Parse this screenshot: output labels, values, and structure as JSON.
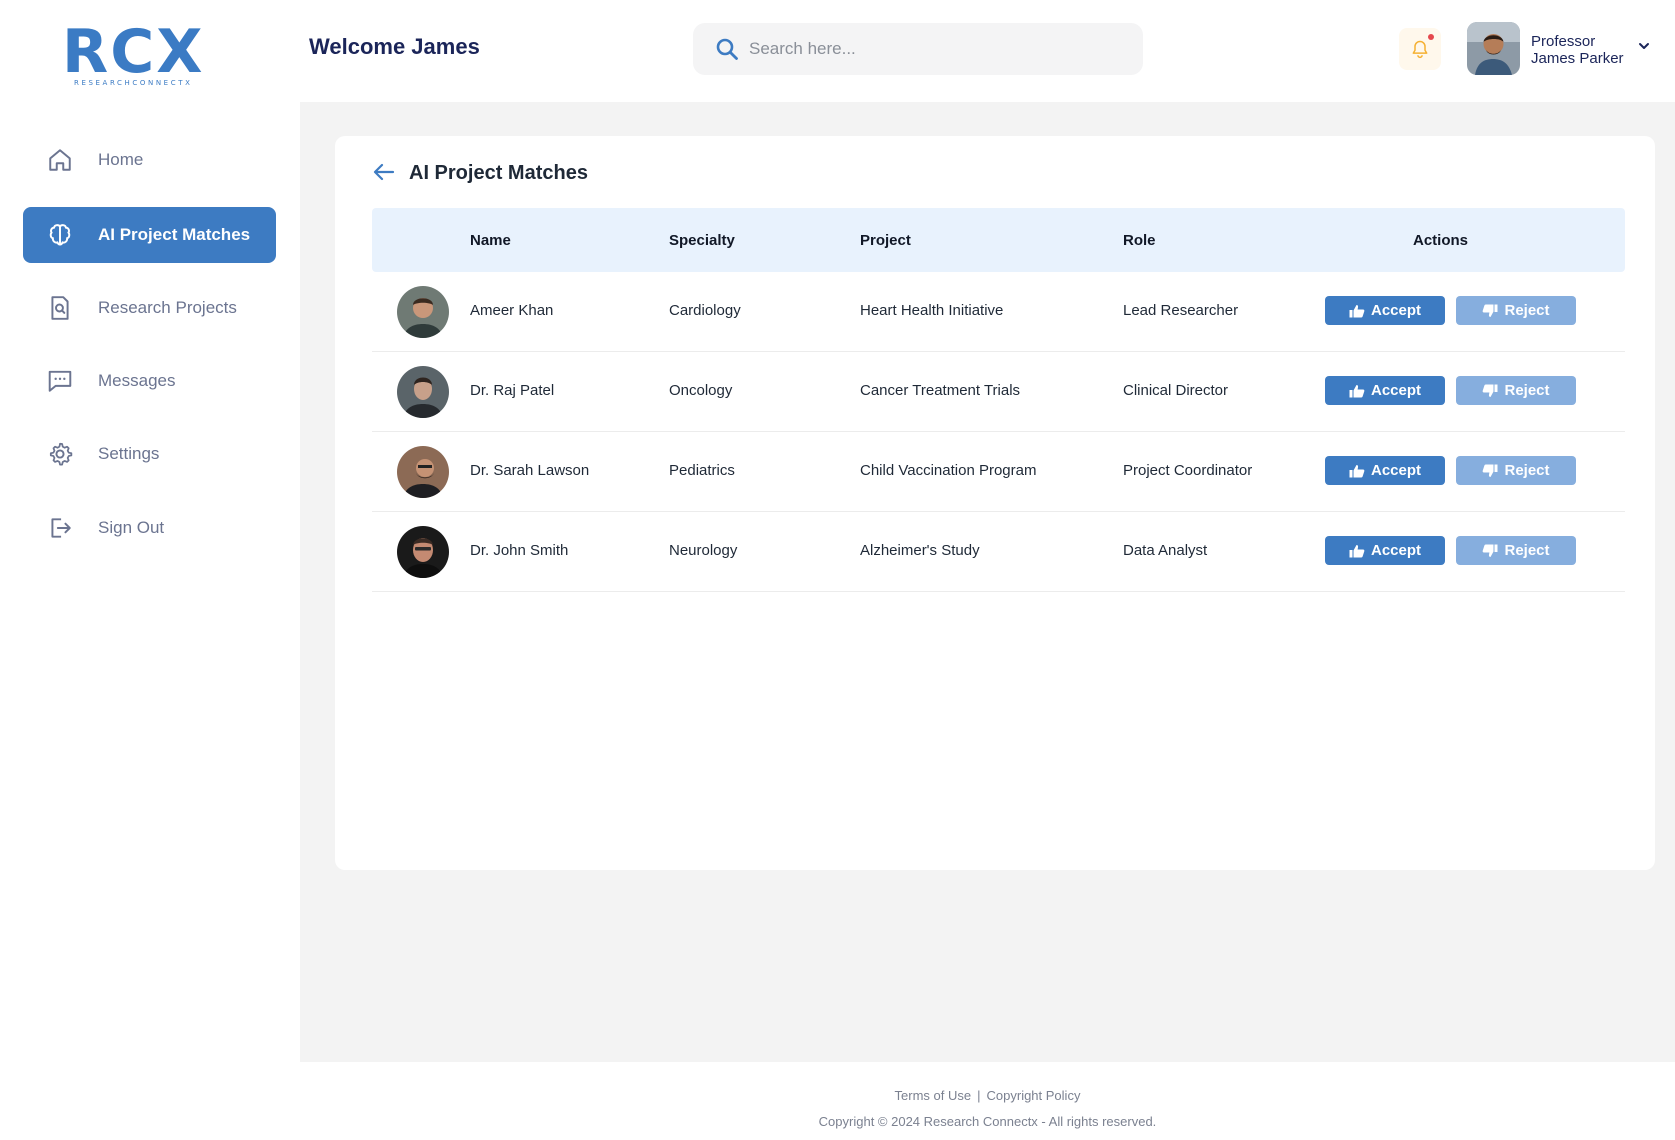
{
  "brand": {
    "logo_text": "RCX",
    "logo_subtext": "RESEARCHCONNECTX",
    "accent": "#3d7bc2"
  },
  "header": {
    "welcome": "Welcome James",
    "search_placeholder": "Search here...",
    "user_name_line1": "Professor",
    "user_name_line2": "James Parker",
    "notification_icon": "bell-icon"
  },
  "sidebar": {
    "items": [
      {
        "label": "Home",
        "icon": "home-icon",
        "active": false
      },
      {
        "label": "AI Project Matches",
        "icon": "brain-icon",
        "active": true
      },
      {
        "label": "Research Projects",
        "icon": "document-search-icon",
        "active": false
      },
      {
        "label": "Messages",
        "icon": "chat-icon",
        "active": false
      },
      {
        "label": "Settings",
        "icon": "gear-icon",
        "active": false
      },
      {
        "label": "Sign Out",
        "icon": "sign-out-icon",
        "active": false
      }
    ]
  },
  "main": {
    "title": "AI Project Matches",
    "columns": [
      "Name",
      "Specialty",
      "Project",
      "Role",
      "Actions"
    ],
    "accept_label": "Accept",
    "reject_label": "Reject",
    "rows": [
      {
        "name": "Ameer Khan",
        "specialty": "Cardiology",
        "project": "Heart Health Initiative",
        "role": "Lead Researcher"
      },
      {
        "name": "Dr. Raj Patel",
        "specialty": "Oncology",
        "project": "Cancer Treatment Trials",
        "role": "Clinical Director"
      },
      {
        "name": "Dr. Sarah Lawson",
        "specialty": "Pediatrics",
        "project": "Child Vaccination Program",
        "role": "Project Coordinator"
      },
      {
        "name": "Dr. John Smith",
        "specialty": "Neurology",
        "project": "Alzheimer's Study",
        "role": "Data Analyst"
      }
    ]
  },
  "footer": {
    "terms": "Terms of Use",
    "separator": "|",
    "copyright_policy": "Copyright Policy",
    "copyright": "Copyright © 2024 Research Connectx - All rights reserved."
  }
}
